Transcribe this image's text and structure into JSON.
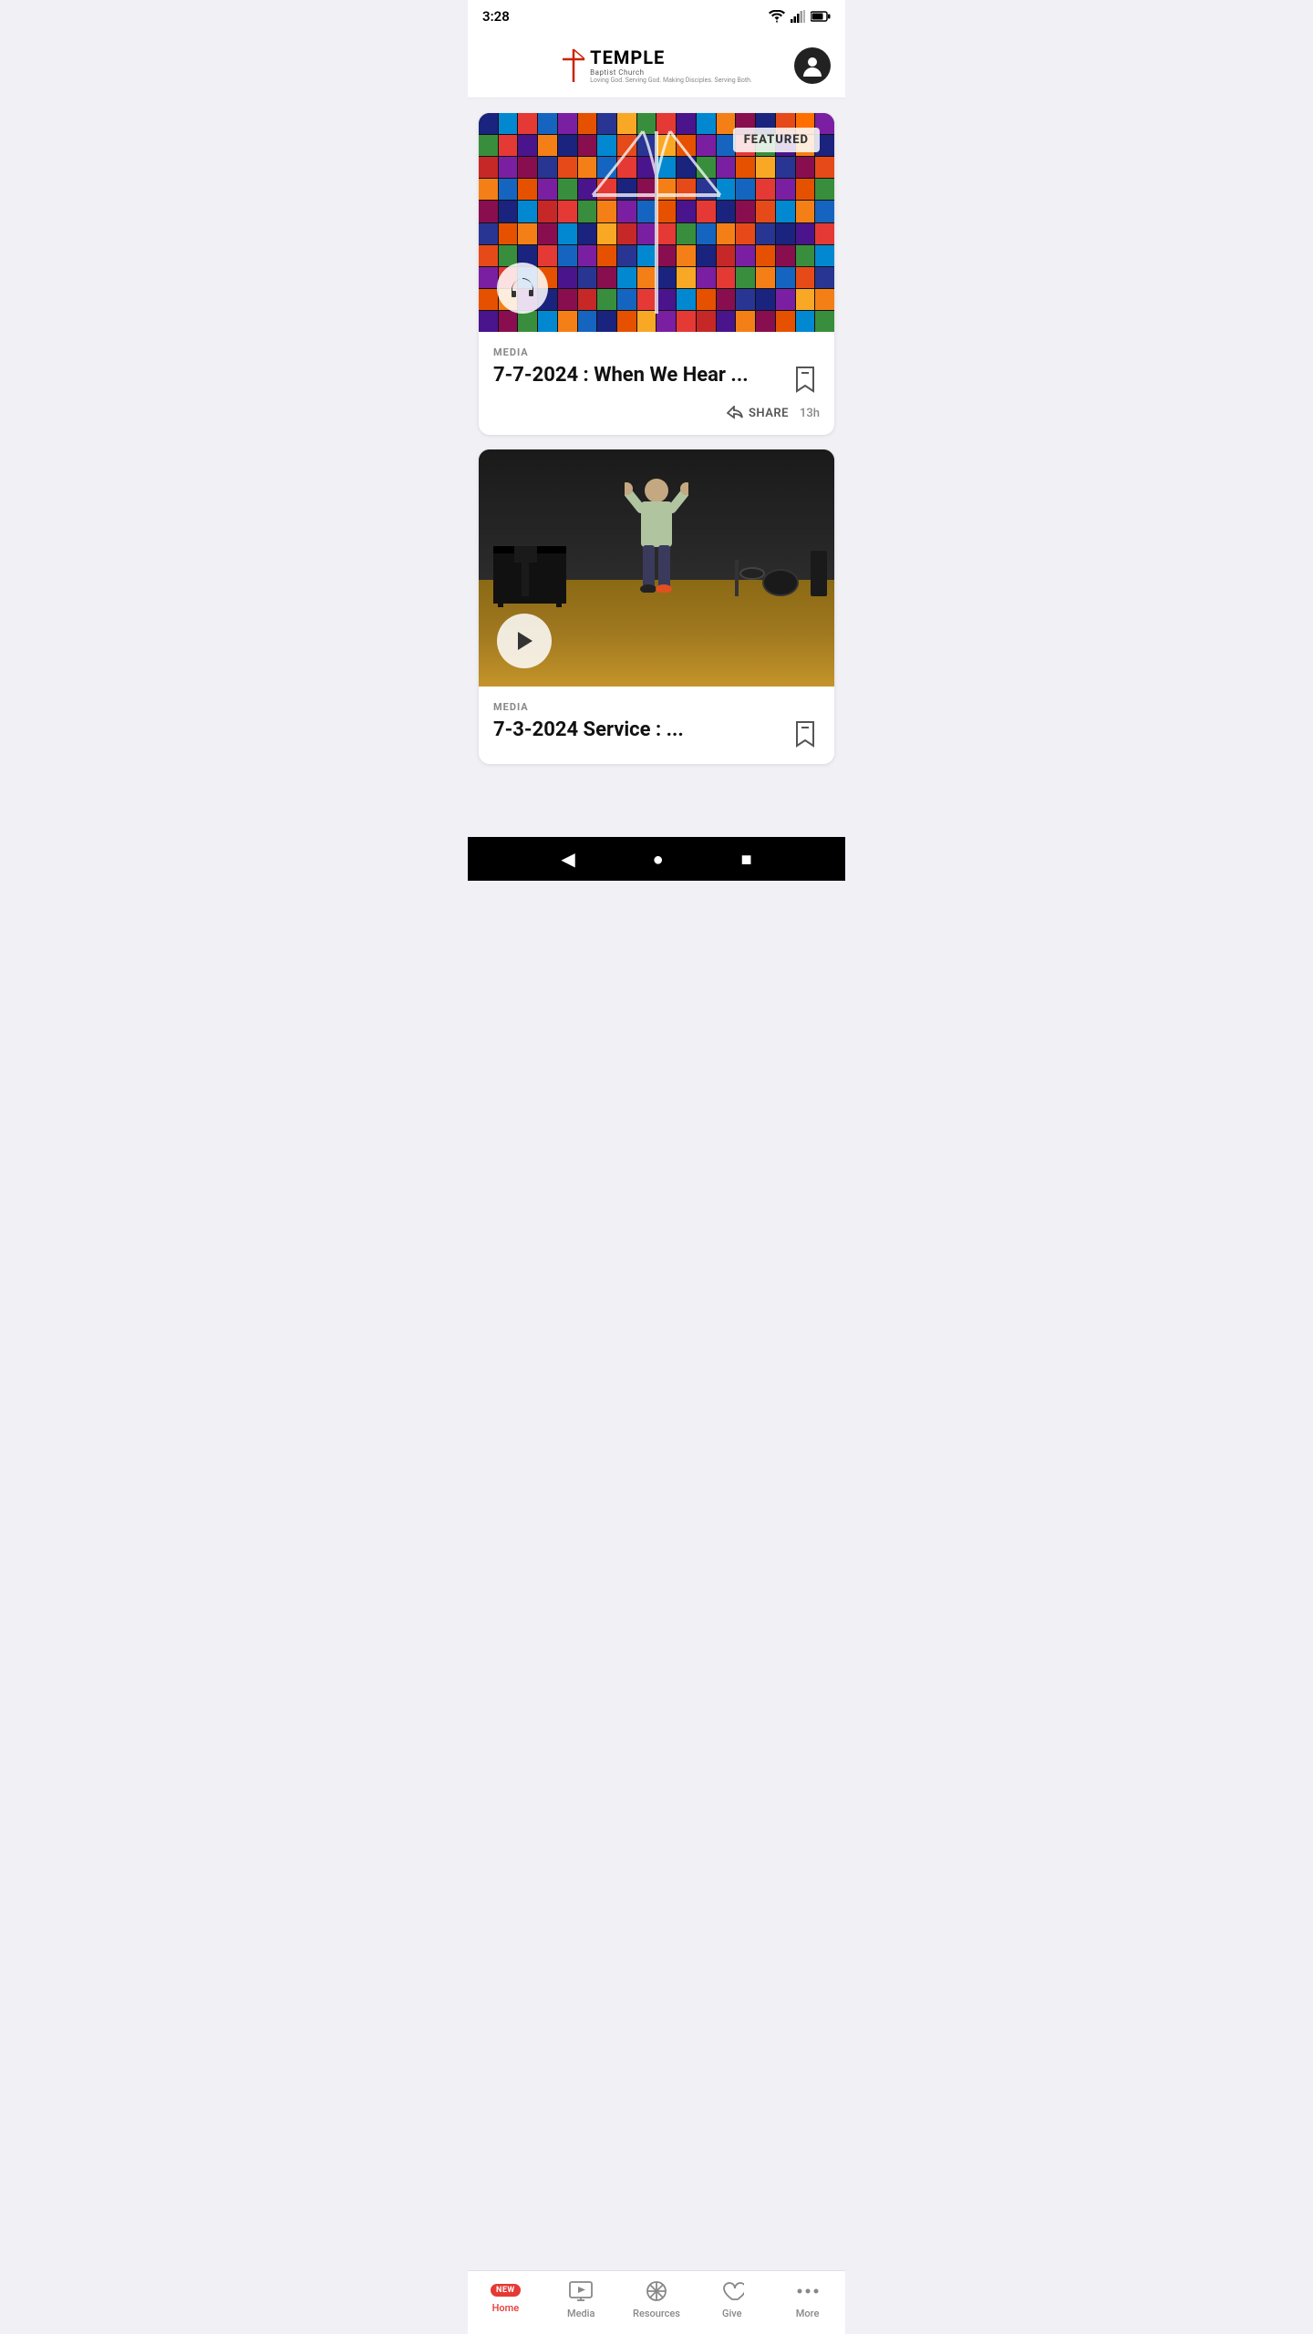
{
  "status_bar": {
    "time": "3:28"
  },
  "header": {
    "logo_temple": "TEMPLE",
    "logo_subtitle": "Baptist Church",
    "logo_tagline": "Loving God. Serving God. Making Disciples. Serving Both."
  },
  "featured_card": {
    "label": "MEDIA",
    "title": "7-7-2024 : When We Hear ...",
    "badge": "FEATURED",
    "share_label": "SHARE",
    "timestamp": "13h",
    "audio_aria": "audio"
  },
  "video_card": {
    "label": "MEDIA",
    "title": "7-3-2024 Service : ...",
    "bookmark_aria": "bookmark",
    "play_aria": "play"
  },
  "bottom_nav": {
    "new_badge": "NEW",
    "items": [
      {
        "id": "home",
        "label": "Home",
        "active": true
      },
      {
        "id": "media",
        "label": "Media",
        "active": false
      },
      {
        "id": "resources",
        "label": "Resources",
        "active": false
      },
      {
        "id": "give",
        "label": "Give",
        "active": false
      },
      {
        "id": "more",
        "label": "More",
        "active": false
      }
    ]
  },
  "android_nav": {
    "back": "◀",
    "home": "●",
    "recent": "■"
  }
}
